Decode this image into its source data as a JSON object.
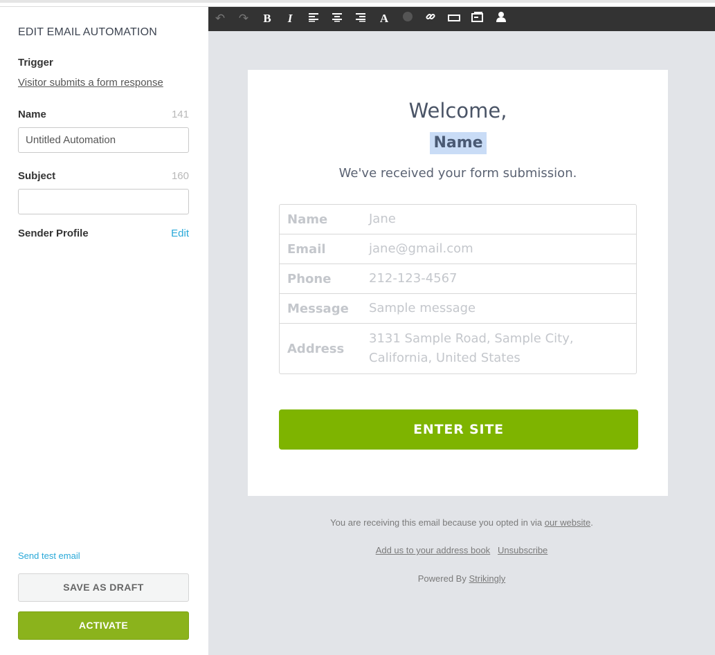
{
  "sidebar": {
    "title": "EDIT EMAIL AUTOMATION",
    "trigger_label": "Trigger",
    "trigger_value": "Visitor submits a form response",
    "name_label": "Name",
    "name_count": "141",
    "name_value": "Untitled Automation",
    "subject_label": "Subject",
    "subject_count": "160",
    "subject_value": "",
    "sender_label": "Sender Profile",
    "sender_edit": "Edit",
    "send_test": "Send test email",
    "save_draft": "SAVE AS DRAFT",
    "activate": "ACTIVATE"
  },
  "toolbar": {
    "undo": "↶",
    "redo": "↷",
    "bold": "B",
    "italic": "I",
    "align_left": "≡",
    "align_center": "≡",
    "align_right": "≡",
    "font": "A",
    "color": "●",
    "link": "🔗",
    "button": "▭",
    "image": "▤",
    "person": "👤"
  },
  "email": {
    "welcome": "Welcome,",
    "name_tag": "Name",
    "received": "We've received your form submission.",
    "fields": [
      {
        "key": "Name",
        "value": "Jane"
      },
      {
        "key": "Email",
        "value": "jane@gmail.com"
      },
      {
        "key": "Phone",
        "value": "212-123-4567"
      },
      {
        "key": "Message",
        "value": "Sample message"
      },
      {
        "key": "Address",
        "value": "3131 Sample Road, Sample City, California, United States"
      }
    ],
    "enter_site": "ENTER SITE"
  },
  "footer": {
    "receiving_prefix": "You are receiving this email because you opted in via ",
    "our_website": "our website",
    "receiving_suffix": ".",
    "address_book": "Add us to your address book",
    "unsubscribe": "Unsubscribe",
    "powered_prefix": "Powered By ",
    "powered_brand": "Strikingly"
  },
  "colors": {
    "accent_link": "#28a8d8",
    "activate_green": "#8bb31c",
    "enter_green": "#7eb400",
    "toolbar_bg": "#333333",
    "canvas_bg": "#e2e4e8"
  }
}
